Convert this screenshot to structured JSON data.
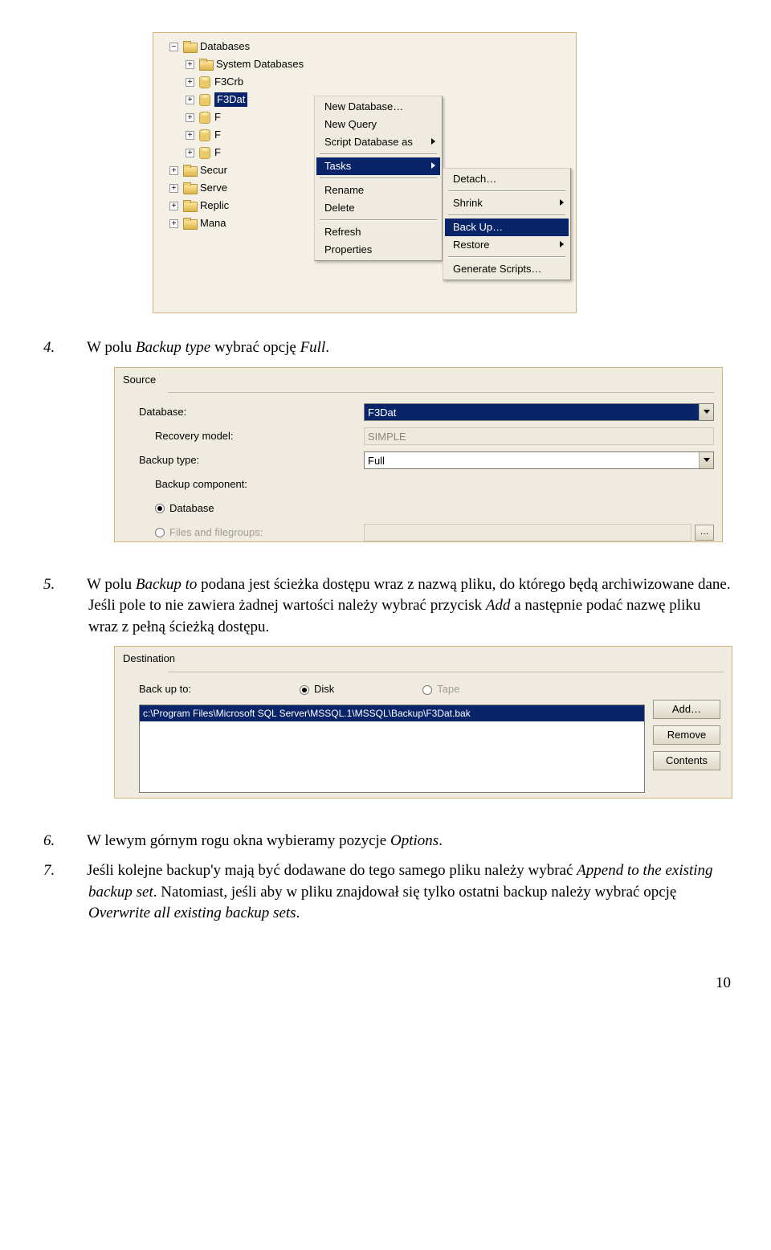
{
  "screenshot1": {
    "tree": {
      "root": "Databases",
      "items": [
        "System Databases",
        "F3Crb",
        "F3Dat",
        "F",
        "F",
        "F"
      ],
      "extra": [
        "Secur",
        "Serve",
        "Replic",
        "Mana"
      ]
    },
    "menu1": {
      "items": [
        "New Database…",
        "New Query",
        "Script Database as",
        "Tasks",
        "Rename",
        "Delete",
        "Refresh",
        "Properties"
      ]
    },
    "menu2": {
      "items": [
        "Detach…",
        "Shrink",
        "Back Up…",
        "Restore",
        "Generate Scripts…"
      ]
    }
  },
  "step4": {
    "num": "4.",
    "text_a": "W polu ",
    "em1": "Backup type",
    "text_b": " wybrać opcję ",
    "em2": "Full",
    "text_c": "."
  },
  "screenshot2": {
    "title": "Source",
    "database_lbl": "Database:",
    "database_val": "F3Dat",
    "recovery_lbl": "Recovery model:",
    "recovery_val": "SIMPLE",
    "backup_type_lbl": "Backup type:",
    "backup_type_val": "Full",
    "component_lbl": "Backup component:",
    "radio_db": "Database",
    "radio_fg": "Files and filegroups:",
    "browse": "…"
  },
  "step5": {
    "num": "5.",
    "text_a": "W polu ",
    "em1": "Backup to",
    "text_b": " podana jest ścieżka dostępu wraz z nazwą pliku, do którego będą archiwizowane dane. Jeśli pole to nie zawiera żadnej wartości należy wybrać przycisk ",
    "em2": "Add",
    "text_c": " a następnie podać nazwę pliku wraz z pełną ścieżką dostępu."
  },
  "screenshot3": {
    "title": "Destination",
    "back_up_to": "Back up to:",
    "disk": "Disk",
    "tape": "Tape",
    "path": "c:\\Program Files\\Microsoft SQL Server\\MSSQL.1\\MSSQL\\Backup\\F3Dat.bak",
    "add": "Add…",
    "remove": "Remove",
    "contents": "Contents"
  },
  "step6": {
    "num": "6.",
    "text_a": "W lewym górnym rogu okna wybieramy pozycje ",
    "em1": "Options",
    "text_b": "."
  },
  "step7": {
    "num": "7.",
    "text_a": "Jeśli kolejne backup'y mają być dodawane do tego samego pliku należy wybrać ",
    "em1": "Append to the existing backup set",
    "text_b": ". Natomiast, jeśli aby w pliku znajdował się tylko ostatni backup należy wybrać opcję ",
    "em2": "Overwrite all existing backup sets",
    "text_c": "."
  },
  "page_number": "10"
}
